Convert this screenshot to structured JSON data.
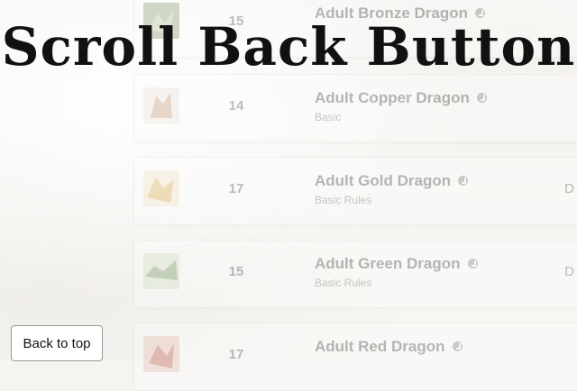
{
  "title": "Scroll Back Button",
  "back_button_label": "Back to top",
  "list": {
    "rows": [
      {
        "cr": "15",
        "name": "Adult Bronze Dragon",
        "source": "",
        "edge": "",
        "thumb_icon": "bronze-dragon-thumbnail",
        "thumb_color": "#7a8f5c"
      },
      {
        "cr": "14",
        "name": "Adult Copper Dragon",
        "source": "Basic",
        "edge": "",
        "thumb_icon": "copper-dragon-thumbnail",
        "thumb_color": "#b9865a"
      },
      {
        "cr": "17",
        "name": "Adult Gold Dragon",
        "source": "Basic Rules",
        "edge": "D",
        "thumb_icon": "gold-dragon-thumbnail",
        "thumb_color": "#d8a43a"
      },
      {
        "cr": "15",
        "name": "Adult Green Dragon",
        "source": "Basic Rules",
        "edge": "D",
        "thumb_icon": "green-dragon-thumbnail",
        "thumb_color": "#5f8a4c"
      },
      {
        "cr": "17",
        "name": "Adult Red Dragon",
        "source": "",
        "edge": "",
        "thumb_icon": "red-dragon-thumbnail",
        "thumb_color": "#b5452e"
      }
    ]
  },
  "colors": {
    "background": "#f7f6f3",
    "title": "#111111",
    "button_border": "#9a9a9a"
  }
}
